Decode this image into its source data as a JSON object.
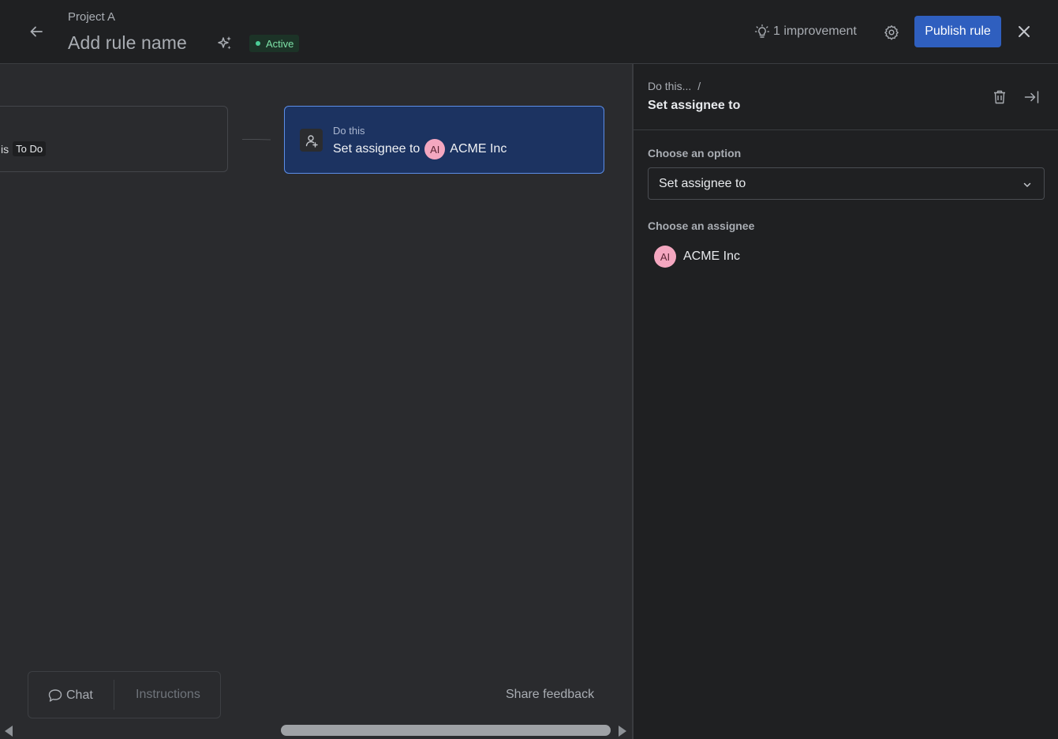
{
  "header": {
    "project": "Project A",
    "rule_name": "Add rule name",
    "status": "Active",
    "improvement": "1 improvement",
    "publish": "Publish rule"
  },
  "canvas": {
    "trigger": {
      "prefix": "is",
      "chip": "To Do"
    },
    "action": {
      "kicker": "Do this",
      "text": "Set assignee to",
      "avatar_initials": "AI",
      "assignee": "ACME Inc"
    },
    "bottom": {
      "chat": "Chat",
      "instructions": "Instructions",
      "share_feedback": "Share feedback"
    }
  },
  "panel": {
    "breadcrumb": "Do this...",
    "breadcrumb_sep": "/",
    "title": "Set assignee to",
    "option_label": "Choose an option",
    "option_value": "Set assignee to",
    "assignee_label": "Choose an assignee",
    "assignee": {
      "initials": "AI",
      "name": "ACME Inc"
    }
  },
  "colors": {
    "accent": "#2f5fbf",
    "status": "#4bce97",
    "avatar": "#f4a7c0"
  },
  "icons": [
    "back-arrow-icon",
    "sparkles-icon",
    "lightbulb-icon",
    "gear-icon",
    "close-icon",
    "person-add-icon",
    "trash-icon",
    "collapse-panel-icon",
    "chevron-down-icon",
    "chat-bubble-icon"
  ]
}
